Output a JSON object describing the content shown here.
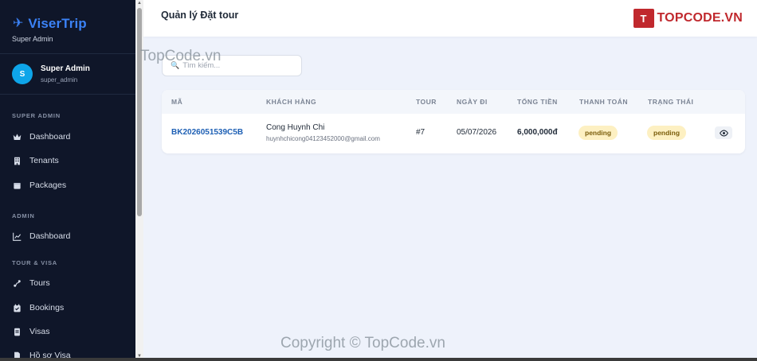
{
  "sidebar": {
    "brand": "ViserTrip",
    "brand_sub": "Super Admin",
    "user": {
      "initial": "S",
      "name": "Super Admin",
      "handle": "super_admin"
    },
    "sections": [
      {
        "label": "SUPER ADMIN",
        "items": [
          {
            "label": "Dashboard",
            "icon": "crown-icon"
          },
          {
            "label": "Tenants",
            "icon": "building-icon"
          },
          {
            "label": "Packages",
            "icon": "box-icon"
          }
        ]
      },
      {
        "label": "ADMIN",
        "items": [
          {
            "label": "Dashboard",
            "icon": "chart-icon"
          }
        ]
      },
      {
        "label": "TOUR & VISA",
        "items": [
          {
            "label": "Tours",
            "icon": "route-icon"
          },
          {
            "label": "Bookings",
            "icon": "calendar-check-icon"
          },
          {
            "label": "Visas",
            "icon": "passport-icon"
          },
          {
            "label": "Hồ sơ Visa",
            "icon": "file-icon"
          }
        ]
      }
    ]
  },
  "header": {
    "title": "Quản lý Đặt tour",
    "logo_mark": "T",
    "logo_text": "TOPCODE.VN"
  },
  "search": {
    "placeholder": "Tìm kiếm..."
  },
  "table": {
    "columns": [
      "MÃ",
      "KHÁCH HÀNG",
      "TOUR",
      "NGÀY ĐI",
      "TỔNG TIỀN",
      "THANH TOÁN",
      "TRẠNG THÁI"
    ],
    "rows": [
      {
        "code": "BK2026051539C5B",
        "customer_name": "Cong Huynh Chi",
        "customer_email": "huynhchicong04123452000@gmail.com",
        "tour": "#7",
        "date": "05/07/2026",
        "total": "6,000,000đ",
        "payment": "pending",
        "status": "pending"
      }
    ]
  },
  "watermarks": {
    "top": "TopCode.vn",
    "bottom": "Copyright © TopCode.vn"
  },
  "colors": {
    "sidebar_bg": "#0f1629",
    "brand": "#3b82f6",
    "link": "#1d5fb4",
    "badge_bg": "#fdf0c2",
    "logo": "#c0282d"
  }
}
